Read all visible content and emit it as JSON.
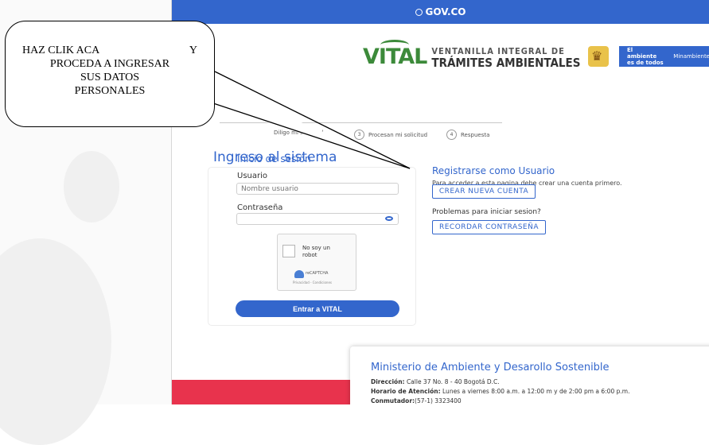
{
  "gov_bar": {
    "label": "GOV.CO"
  },
  "logo": {
    "word": "VITAL",
    "line1": "VENTANILLA INTEGRAL DE",
    "line2": "TRÁMITES AMBIENTALES"
  },
  "ambiente": {
    "slogan": "El ambiente es de todos",
    "ministry": "Minambiente"
  },
  "steps": [
    {
      "label": "Diligo mi solicitud"
    },
    {
      "number": "3",
      "label": "Procesan mi solicitud"
    },
    {
      "number": "4",
      "label": "Respuesta"
    }
  ],
  "page_title": "Ingreso al sistema",
  "login": {
    "title": "Inicio de sesión",
    "user_label": "Usuario",
    "user_placeholder": "Nombre usuario",
    "password_label": "Contraseña",
    "password_value": "",
    "captcha_text": "No soy un robot",
    "captcha_brand": "reCAPTCHA",
    "captcha_links": "Privacidad - Condiciones",
    "submit_label": "Entrar a VITAL"
  },
  "register": {
    "title": "Registrarse como Usuario",
    "description": "Para acceder a esta pagina debe crear una cuenta primero.",
    "create_label": "CREAR NUEVA CUENTA",
    "problems": "Problemas para iniciar sesion?",
    "remember_label": "RECORDAR CONTRASEÑA"
  },
  "footer": {
    "ministry": "Ministerio de Ambiente y Desarollo Sostenible",
    "address_label": "Dirección:",
    "address": "Calle 37 No. 8 - 40 Bogotá D.C.",
    "hours_label": "Horario de Atención:",
    "hours": "Lunes a viernes 8:00 a.m. a 12:00 m y de 2:00 pm a 6:00 p.m.",
    "phone_label": "Conmutador:",
    "phone": "(57-1) 3323400"
  },
  "callout": {
    "line1a": "HAZ CLIK ACA",
    "line1b": "Y",
    "line2": "PROCEDA A INGRESAR",
    "line3": "SUS DATOS",
    "line4": "PERSONALES"
  },
  "colors": {
    "gov_blue": "#3366cc",
    "vital_green": "#3c8a3a",
    "footer_pink": "#e8334d"
  }
}
